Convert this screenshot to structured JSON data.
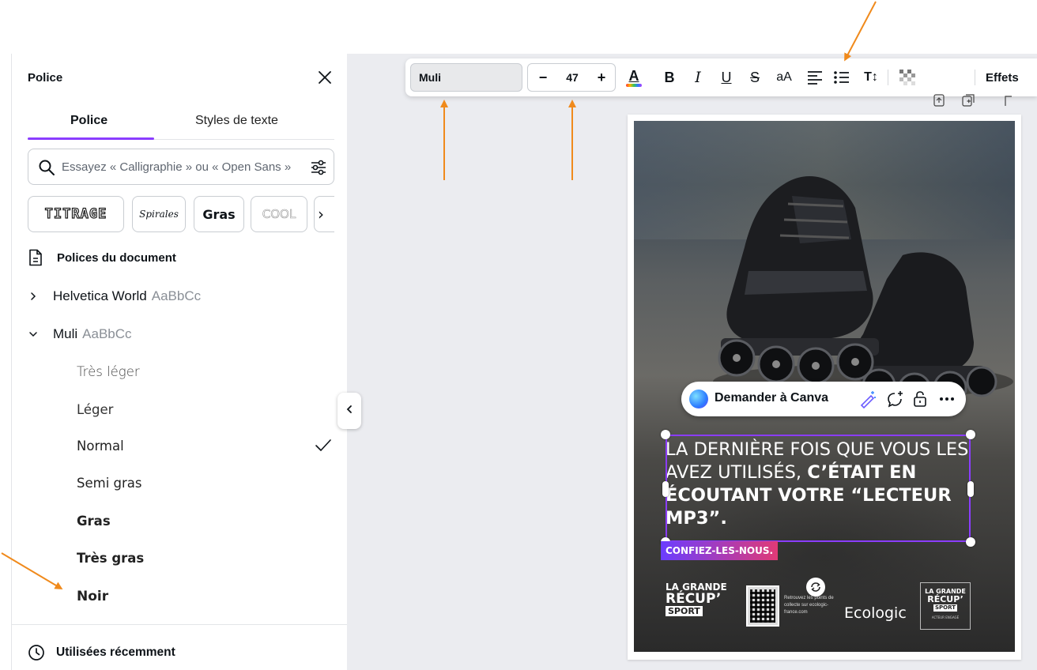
{
  "panel": {
    "title": "Police",
    "tabs": [
      {
        "label": "Police",
        "active": true
      },
      {
        "label": "Styles de texte",
        "active": false
      }
    ],
    "search": {
      "placeholder": "Essayez « Calligraphie » ou « Open Sans »"
    },
    "chips": [
      "TITRAGE",
      "Spirales",
      "Gras",
      "COOL"
    ],
    "document_fonts": {
      "heading": "Polices du document",
      "fonts": [
        {
          "name": "Helvetica World",
          "sample": "AaBbCc",
          "expanded": false
        },
        {
          "name": "Muli",
          "sample": "AaBbCc",
          "expanded": true
        }
      ],
      "weights": [
        "Très léger",
        "Léger",
        "Normal",
        "Semi gras",
        "Gras",
        "Très gras",
        "Noir"
      ],
      "selected_weight": "Normal"
    },
    "recent": {
      "label": "Utilisées récemment"
    }
  },
  "toolbar": {
    "font": "Muli",
    "size": "47",
    "minus": "−",
    "plus": "+",
    "color_letter": "A",
    "bold": "B",
    "italic": "I",
    "underline": "U",
    "strike": "S",
    "case": "aA",
    "spacing": "T↕",
    "effects": "Effets"
  },
  "canvas": {
    "ask_canva": "Demander à Canva",
    "headline": {
      "light": "LA DERNIÈRE FOIS QUE VOUS LES AVEZ UTILISÉS,",
      "bold": "C’ÉTAIT EN ÉCOUTANT VOTRE “LECTEUR MP3”."
    },
    "cta": "CONFIEZ-LES-NOUS.",
    "logo_left": {
      "line1": "LA GRANDE",
      "line2": "RÉCUP’",
      "line3": "SPORT"
    },
    "retrouvez": "Retrouvez les points de collecte sur ecologic-france.com",
    "ecologic": "Ecologic",
    "logo_right": {
      "line1": "LA GRANDE",
      "line2": "RÉCUP’",
      "line3": "SPORT",
      "line4": "ACTEUR ENGAGÉ"
    }
  },
  "colors": {
    "accent": "#8b3dff",
    "annotation_arrow": "#f08a1c",
    "cta_gradient": [
      "#6b3dff",
      "#e03a76"
    ]
  },
  "icons": [
    "close-icon",
    "search-icon",
    "filter-icon",
    "document-icon",
    "chevron-right-icon",
    "chevron-down-icon",
    "check-icon",
    "clock-icon",
    "chevron-left-icon",
    "text-color-icon",
    "align-left-icon",
    "bullet-list-icon",
    "transparency-icon",
    "magic-edit-icon",
    "comment-icon",
    "lock-icon",
    "more-icon"
  ]
}
